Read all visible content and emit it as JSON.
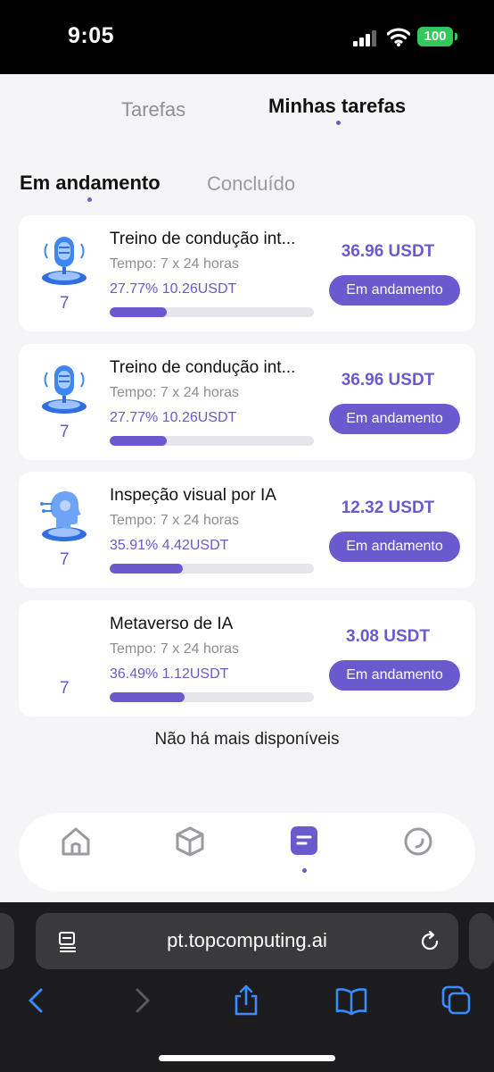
{
  "status_bar": {
    "time": "9:05",
    "battery": "100"
  },
  "top_tabs": {
    "tasks": "Tarefas",
    "my_tasks": "Minhas tarefas"
  },
  "sub_tabs": {
    "in_progress": "Em andamento",
    "completed": "Concluído"
  },
  "cards": [
    {
      "level": "7",
      "title": "Treino de condução int...",
      "time": "Tempo: 7 x 24 horas",
      "profit": "27.77% 10.26USDT",
      "progress": 0.2777,
      "amount": "36.96 USDT",
      "status": "Em andamento",
      "icon": "microphone-ai-icon"
    },
    {
      "level": "7",
      "title": "Treino de condução int...",
      "time": "Tempo: 7 x 24 horas",
      "profit": "27.77% 10.26USDT",
      "progress": 0.2777,
      "amount": "36.96 USDT",
      "status": "Em andamento",
      "icon": "microphone-ai-icon"
    },
    {
      "level": "7",
      "title": "Inspeção visual por IA",
      "time": "Tempo: 7 x 24 horas",
      "profit": "35.91% 4.42USDT",
      "progress": 0.3591,
      "amount": "12.32 USDT",
      "status": "Em andamento",
      "icon": "ai-head-icon"
    },
    {
      "level": "7",
      "title": "Metaverso de IA",
      "time": "Tempo: 7 x 24 horas",
      "profit": "36.49% 1.12USDT",
      "progress": 0.3649,
      "amount": "3.08 USDT",
      "status": "Em andamento",
      "icon": ""
    }
  ],
  "footer_message": "Não há mais disponíveis",
  "bottom_nav": [
    "home-icon",
    "cube-icon",
    "tasks-icon",
    "profile-icon"
  ],
  "browser": {
    "url": "pt.topcomputing.ai"
  },
  "colors": {
    "accent": "#6a5acd",
    "background": "#f5f5f7"
  }
}
